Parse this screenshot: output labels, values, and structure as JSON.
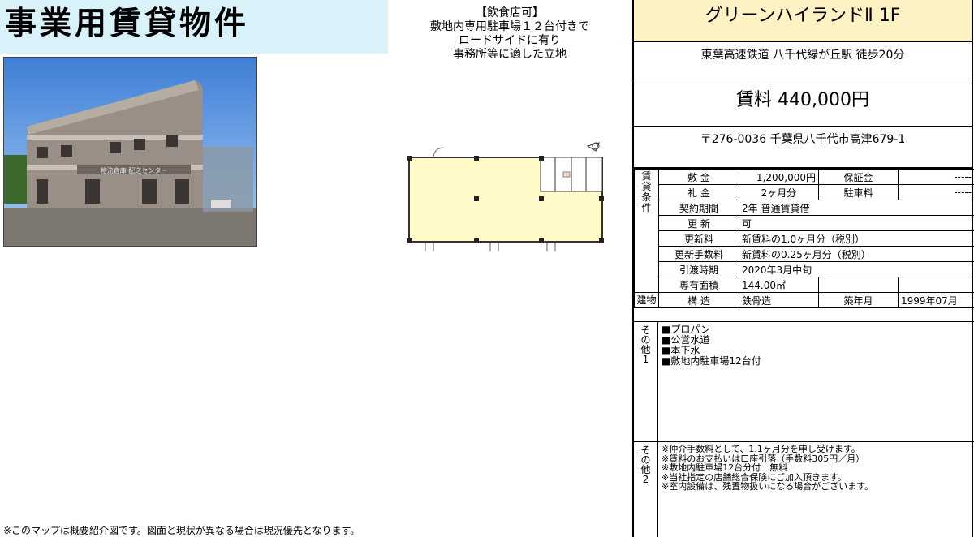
{
  "header": {
    "title": "事業用賃貸物件"
  },
  "notes_top": [
    "【飲食店可】",
    "敷地内専用駐車場１２台付きで",
    "ロードサイドに有り",
    "事務所等に適した立地"
  ],
  "photo": {
    "sign_text": "物流倉庫 配送センター"
  },
  "footer_note": "※このマップは概要紹介図です。図面と現状が異なる場合は現況優先となります。",
  "property": {
    "name": "グリーンハイランドⅡ 1F",
    "station": "東葉高速鉄道 八千代緑が丘駅 徒歩20分",
    "rent": "賃料 440,000円",
    "address": "〒276-0036 千葉県八千代市高津679-1"
  },
  "terms": {
    "section_label": [
      "賃",
      "貸",
      "条",
      "件"
    ],
    "deposit_label": "敷 金",
    "deposit": "1,200,000円",
    "guarantee_label": "保証金",
    "guarantee": "-----",
    "key_money_label": "礼 金",
    "key_money": "2ヶ月分",
    "parking_label": "駐車料",
    "parking": "-----",
    "contract_label": "契約期間",
    "contract": "2年 普通賃貸借",
    "renewal_label": "更 新",
    "renewal": "可",
    "renewal_fee_label": "更新料",
    "renewal_fee": "新賃料の1.0ヶ月分（税別）",
    "renewal_commission_label": "更新手数料",
    "renewal_commission": "新賃料の0.25ヶ月分（税別）",
    "handover_label": "引渡時期",
    "handover": "2020年3月中旬",
    "area_label": "専有面積",
    "area": "144.00㎡",
    "building_label": "建物",
    "structure_label": "構 造",
    "structure": "鉄骨造",
    "built_label": "築年月",
    "built": "1999年07月"
  },
  "other1": {
    "label": [
      "そ",
      "の",
      "他",
      "1"
    ],
    "items": [
      "■プロパン",
      "■公営水道",
      "■本下水",
      "■敷地内駐車場12台付"
    ]
  },
  "other2": {
    "label": [
      "そ",
      "の",
      "他",
      "2"
    ],
    "items": [
      "※仲介手数料として、1.1ヶ月分を申し受けます。",
      "※賃料のお支払いは口座引落（手数料305円／月）",
      "※敷地内駐車場12台分付　無料",
      "※当社指定の店舗総合保険にご加入頂きます。",
      "※室内設備は、残置物扱いになる場合がございます。"
    ]
  }
}
